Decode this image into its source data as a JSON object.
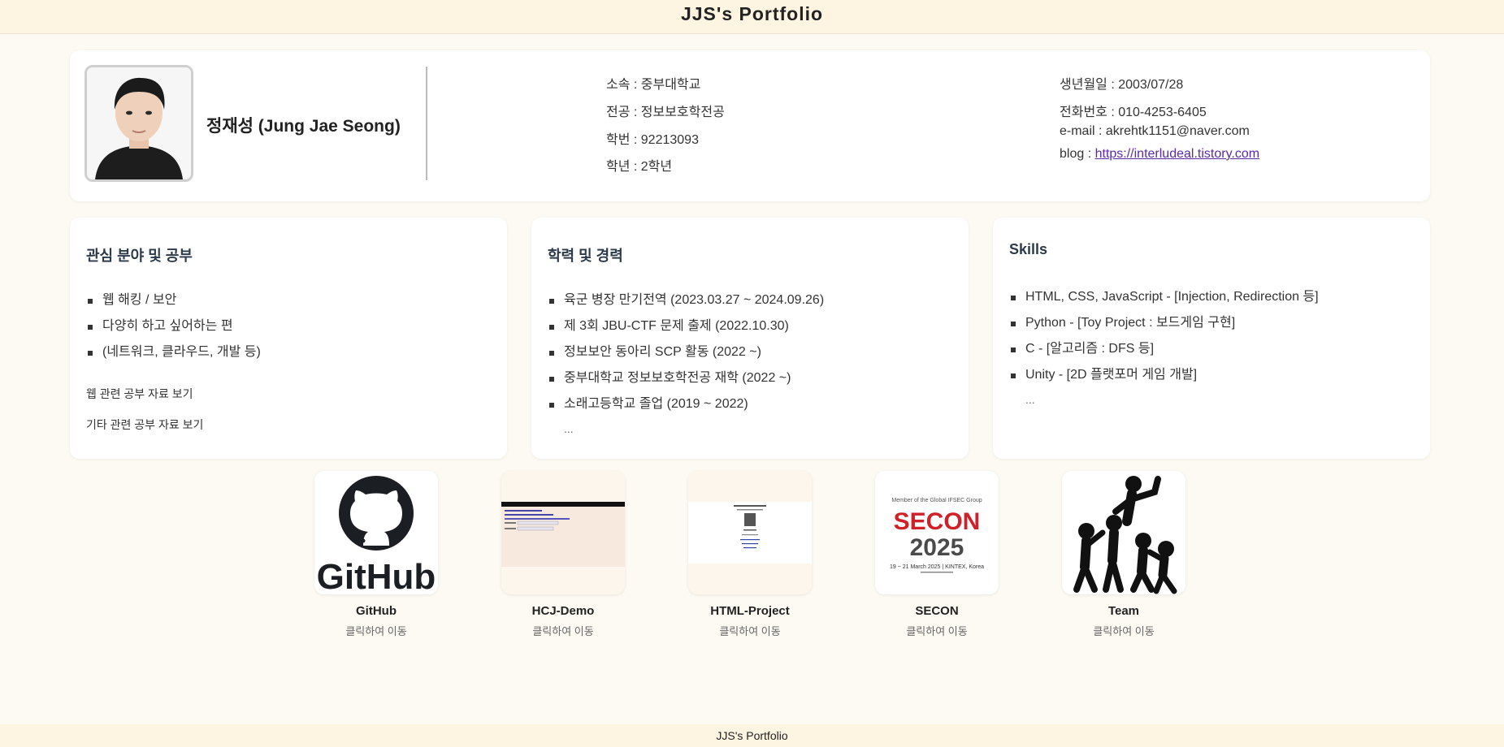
{
  "header": {
    "title": "JJS's Portfolio"
  },
  "profile": {
    "name": "정재성 (Jung Jae Seong)",
    "left_info": [
      "소속 : 중부대학교",
      "전공 : 정보보호학전공",
      "학번 : 92213093",
      "학년 : 2학년"
    ],
    "right_info": {
      "birth": "생년월일 : 2003/07/28",
      "phone": "전화번호 : 010-4253-6405",
      "email": "e-mail : akrehtk1151@naver.com",
      "blog_label": "blog : ",
      "blog_url": "https://interludeal.tistory.com"
    }
  },
  "interests": {
    "title": "관심 분야 및 공부",
    "items": [
      "웹 해킹 / 보안",
      "다양히 하고 싶어하는 편",
      "(네트워크, 클라우드, 개발 등)"
    ],
    "links": [
      "웹 관련 공부 자료 보기",
      "기타 관련 공부 자료 보기"
    ]
  },
  "career": {
    "title": "학력 및 경력",
    "items": [
      "육군 병장 만기전역 (2023.03.27 ~ 2024.09.26)",
      "제 3회 JBU-CTF 문제 출제 (2022.10.30)",
      "정보보안 동아리 SCP 활동 (2022 ~)",
      "중부대학교 정보보호학전공 재학 (2022 ~)",
      "소래고등학교 졸업 (2019 ~ 2022)"
    ],
    "ellipsis": "..."
  },
  "skills": {
    "title": "Skills",
    "items": [
      "HTML, CSS, JavaScript - [Injection, Redirection 등]",
      "Python - [Toy Project : 보드게임 구현]",
      "C - [알고리즘 : DFS 등]",
      "Unity - [2D 플랫포머 게임 개발]"
    ],
    "ellipsis": "..."
  },
  "projects": [
    {
      "title": "GitHub",
      "sub": "클릭하여 이동",
      "icon": "github-logo"
    },
    {
      "title": "HCJ-Demo",
      "sub": "클릭하여 이동",
      "icon": "webpage-screenshot"
    },
    {
      "title": "HTML-Project",
      "sub": "클릭하여 이동",
      "icon": "webpage-screenshot"
    },
    {
      "title": "SECON",
      "sub": "클릭하여 이동",
      "icon": "secon-2025-logo",
      "logo_text": {
        "top": "Member of the Global IFSEC Group",
        "brand": "SECON",
        "year": "2025",
        "date": "19 ~ 21 March 2025 | KINTEX, Korea"
      }
    },
    {
      "title": "Team",
      "sub": "클릭하여 이동",
      "icon": "team-people-icon"
    }
  ],
  "footer": {
    "text": "JJS's Portfolio"
  },
  "colors": {
    "background": "#fdfaf3",
    "header_bg": "#fdf4e2",
    "link": "#5a2aa8",
    "secon_red": "#d0202a"
  }
}
